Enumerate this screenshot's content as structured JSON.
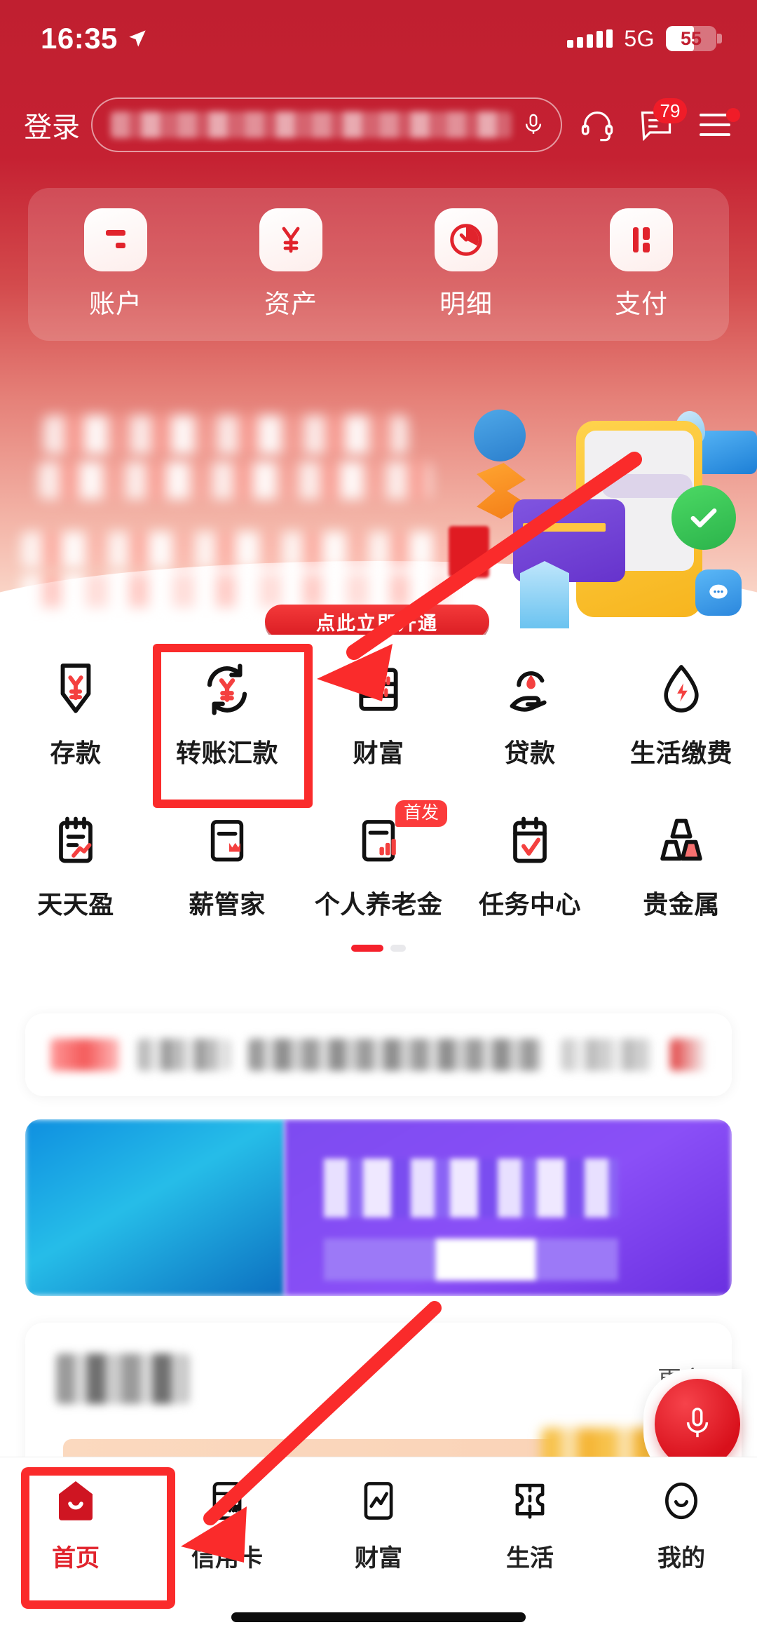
{
  "status_bar": {
    "time": "16:35",
    "location_icon": "location-arrow-icon",
    "network": "5G",
    "battery_level": "55",
    "signal_icon": "signal-bars-icon"
  },
  "header": {
    "login_label": "登录",
    "search_placeholder": "",
    "mic_icon": "microphone-icon",
    "headset_icon": "headset-icon",
    "message_icon": "message-icon",
    "message_badge": "79",
    "menu_icon": "hamburger-menu-icon"
  },
  "quick_actions": [
    {
      "label": "账户",
      "icon": "bank-card-icon"
    },
    {
      "label": "资产",
      "icon": "yuan-asset-icon"
    },
    {
      "label": "明细",
      "icon": "pie-chart-icon"
    },
    {
      "label": "支付",
      "icon": "payment-bars-icon"
    }
  ],
  "banner": {
    "cta_label": "点此立即开通",
    "illustration": "phone-card-checkmark-3d-illustration"
  },
  "grid": {
    "row1": [
      {
        "label": "存款",
        "icon": "deposit-arrow-yuan-icon"
      },
      {
        "label": "转账汇款",
        "icon": "transfer-circular-yuan-icon"
      },
      {
        "label": "财富",
        "icon": "abacus-icon"
      },
      {
        "label": "贷款",
        "icon": "hand-coin-icon"
      },
      {
        "label": "生活缴费",
        "icon": "droplet-lightning-icon"
      }
    ],
    "row2": [
      {
        "label": "天天盈",
        "icon": "notepad-growth-icon",
        "badge": ""
      },
      {
        "label": "薪管家",
        "icon": "phone-crown-icon",
        "badge": ""
      },
      {
        "label": "个人养老金",
        "icon": "phone-bars-icon",
        "badge": "首发"
      },
      {
        "label": "任务中心",
        "icon": "calendar-check-icon",
        "badge": ""
      },
      {
        "label": "贵金属",
        "icon": "gold-ingots-icon",
        "badge": ""
      }
    ],
    "page_dots": {
      "total": 2,
      "active": 1
    }
  },
  "bottom_card": {
    "more_label": "更多"
  },
  "floating": {
    "mic_icon": "microphone-icon"
  },
  "tabbar": [
    {
      "label": "首页",
      "icon": "home-icon",
      "active": true
    },
    {
      "label": "信用卡",
      "icon": "credit-card-icon",
      "active": false
    },
    {
      "label": "财富",
      "icon": "chart-line-icon",
      "active": false
    },
    {
      "label": "生活",
      "icon": "ticket-icon",
      "active": false
    },
    {
      "label": "我的",
      "icon": "person-smile-icon",
      "active": false
    }
  ],
  "annotations": {
    "highlight_transfer": "转账汇款",
    "highlight_home": "首页",
    "arrow_color": "#fa2b2b"
  },
  "colors": {
    "brand_red": "#c01f30",
    "accent_red": "#e1232c",
    "annotation_red": "#fa2b2b",
    "badge_red": "#f01c28"
  }
}
